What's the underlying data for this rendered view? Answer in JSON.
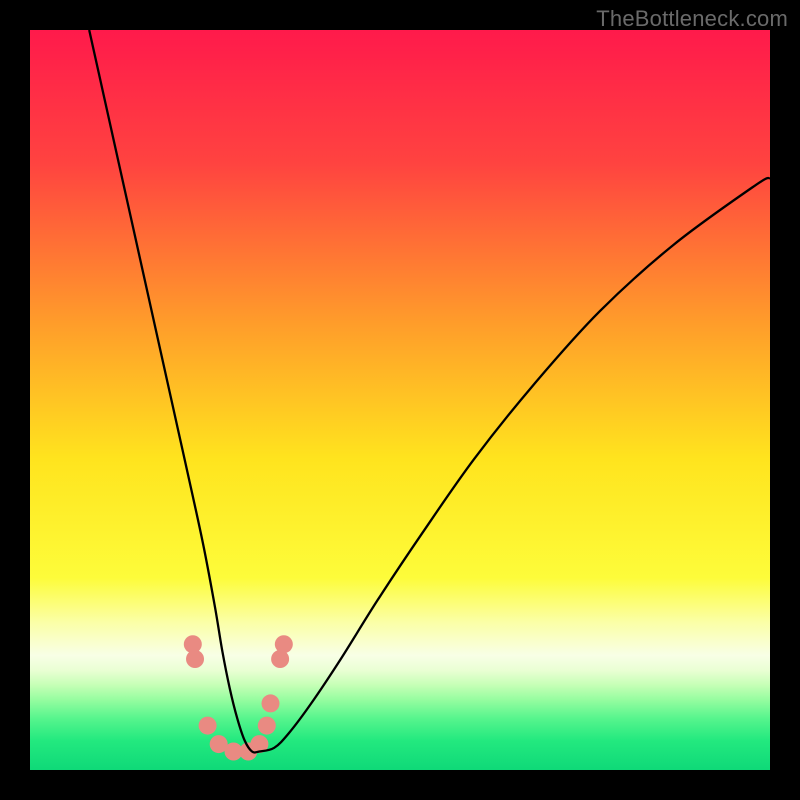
{
  "watermark": "TheBottleneck.com",
  "chart_data": {
    "type": "line",
    "title": "",
    "xlabel": "",
    "ylabel": "",
    "xlim": [
      0,
      100
    ],
    "ylim": [
      0,
      100
    ],
    "grid": false,
    "legend": false,
    "gradient_stops": [
      {
        "offset": 0.0,
        "color": "#ff1a4b"
      },
      {
        "offset": 0.18,
        "color": "#ff4340"
      },
      {
        "offset": 0.4,
        "color": "#ff9e2a"
      },
      {
        "offset": 0.58,
        "color": "#ffe41e"
      },
      {
        "offset": 0.74,
        "color": "#fdfc3a"
      },
      {
        "offset": 0.8,
        "color": "#fbffa6"
      },
      {
        "offset": 0.845,
        "color": "#f8ffe6"
      },
      {
        "offset": 0.865,
        "color": "#eaffd4"
      },
      {
        "offset": 0.885,
        "color": "#c6ffb6"
      },
      {
        "offset": 0.905,
        "color": "#96fda0"
      },
      {
        "offset": 0.93,
        "color": "#57f58d"
      },
      {
        "offset": 0.96,
        "color": "#23e97f"
      },
      {
        "offset": 1.0,
        "color": "#0fd978"
      }
    ],
    "series": [
      {
        "name": "bottleneck-curve",
        "color": "#000000",
        "width": 2.3,
        "x": [
          8,
          10,
          12,
          14,
          16,
          18,
          20,
          22,
          23.5,
          25,
          26,
          27,
          28,
          29,
          30,
          31,
          33,
          35,
          38,
          42,
          47,
          53,
          60,
          68,
          77,
          87,
          98,
          100
        ],
        "values": [
          100,
          91,
          82,
          73,
          64,
          55,
          46,
          37,
          30,
          22,
          16,
          11,
          7,
          4,
          2.5,
          2.5,
          3,
          5,
          9,
          15,
          23,
          32,
          42,
          52,
          62,
          71,
          79,
          80
        ]
      }
    ],
    "markers": {
      "name": "highlight-dots",
      "color": "#e98a82",
      "radius": 9,
      "points": [
        {
          "x": 22.0,
          "y": 17.0
        },
        {
          "x": 22.3,
          "y": 15.0
        },
        {
          "x": 24.0,
          "y": 6.0
        },
        {
          "x": 25.5,
          "y": 3.5
        },
        {
          "x": 27.5,
          "y": 2.5
        },
        {
          "x": 29.5,
          "y": 2.5
        },
        {
          "x": 31.0,
          "y": 3.5
        },
        {
          "x": 32.0,
          "y": 6.0
        },
        {
          "x": 32.5,
          "y": 9.0
        },
        {
          "x": 33.8,
          "y": 15.0
        },
        {
          "x": 34.3,
          "y": 17.0
        }
      ]
    }
  }
}
